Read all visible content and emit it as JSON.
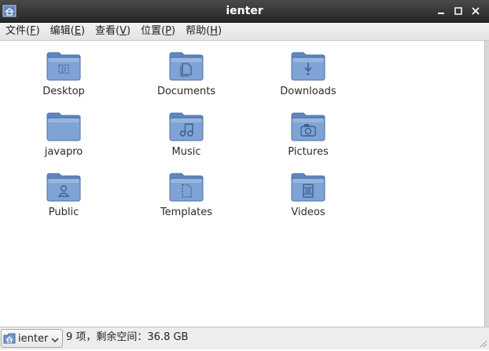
{
  "window": {
    "title": "ienter",
    "buttons": [
      "minimize-icon",
      "maximize-icon",
      "close-icon"
    ]
  },
  "menu": [
    {
      "label": "文件(",
      "mnemonic": "F",
      "close": ")"
    },
    {
      "label": "编辑(",
      "mnemonic": "E",
      "close": ")"
    },
    {
      "label": "查看(",
      "mnemonic": "V",
      "close": ")"
    },
    {
      "label": "位置(",
      "mnemonic": "P",
      "close": ")"
    },
    {
      "label": "帮助(",
      "mnemonic": "H",
      "close": ")"
    }
  ],
  "folders": [
    {
      "name": "Desktop",
      "icon": "desktop-folder-icon"
    },
    {
      "name": "Documents",
      "icon": "documents-folder-icon"
    },
    {
      "name": "Downloads",
      "icon": "downloads-folder-icon"
    },
    {
      "name": "javapro",
      "icon": "folder-icon"
    },
    {
      "name": "Music",
      "icon": "music-folder-icon"
    },
    {
      "name": "Pictures",
      "icon": "pictures-folder-icon"
    },
    {
      "name": "Public",
      "icon": "public-folder-icon"
    },
    {
      "name": "Templates",
      "icon": "templates-folder-icon"
    },
    {
      "name": "Videos",
      "icon": "videos-folder-icon"
    }
  ],
  "statusbar": {
    "location": "ienter",
    "info": "9 项，剩余空间：36.8 GB"
  },
  "colors": {
    "titlebar": "#2f2f2f",
    "folder_body": "#7ea3d4",
    "folder_tab": "#5f86bd"
  }
}
